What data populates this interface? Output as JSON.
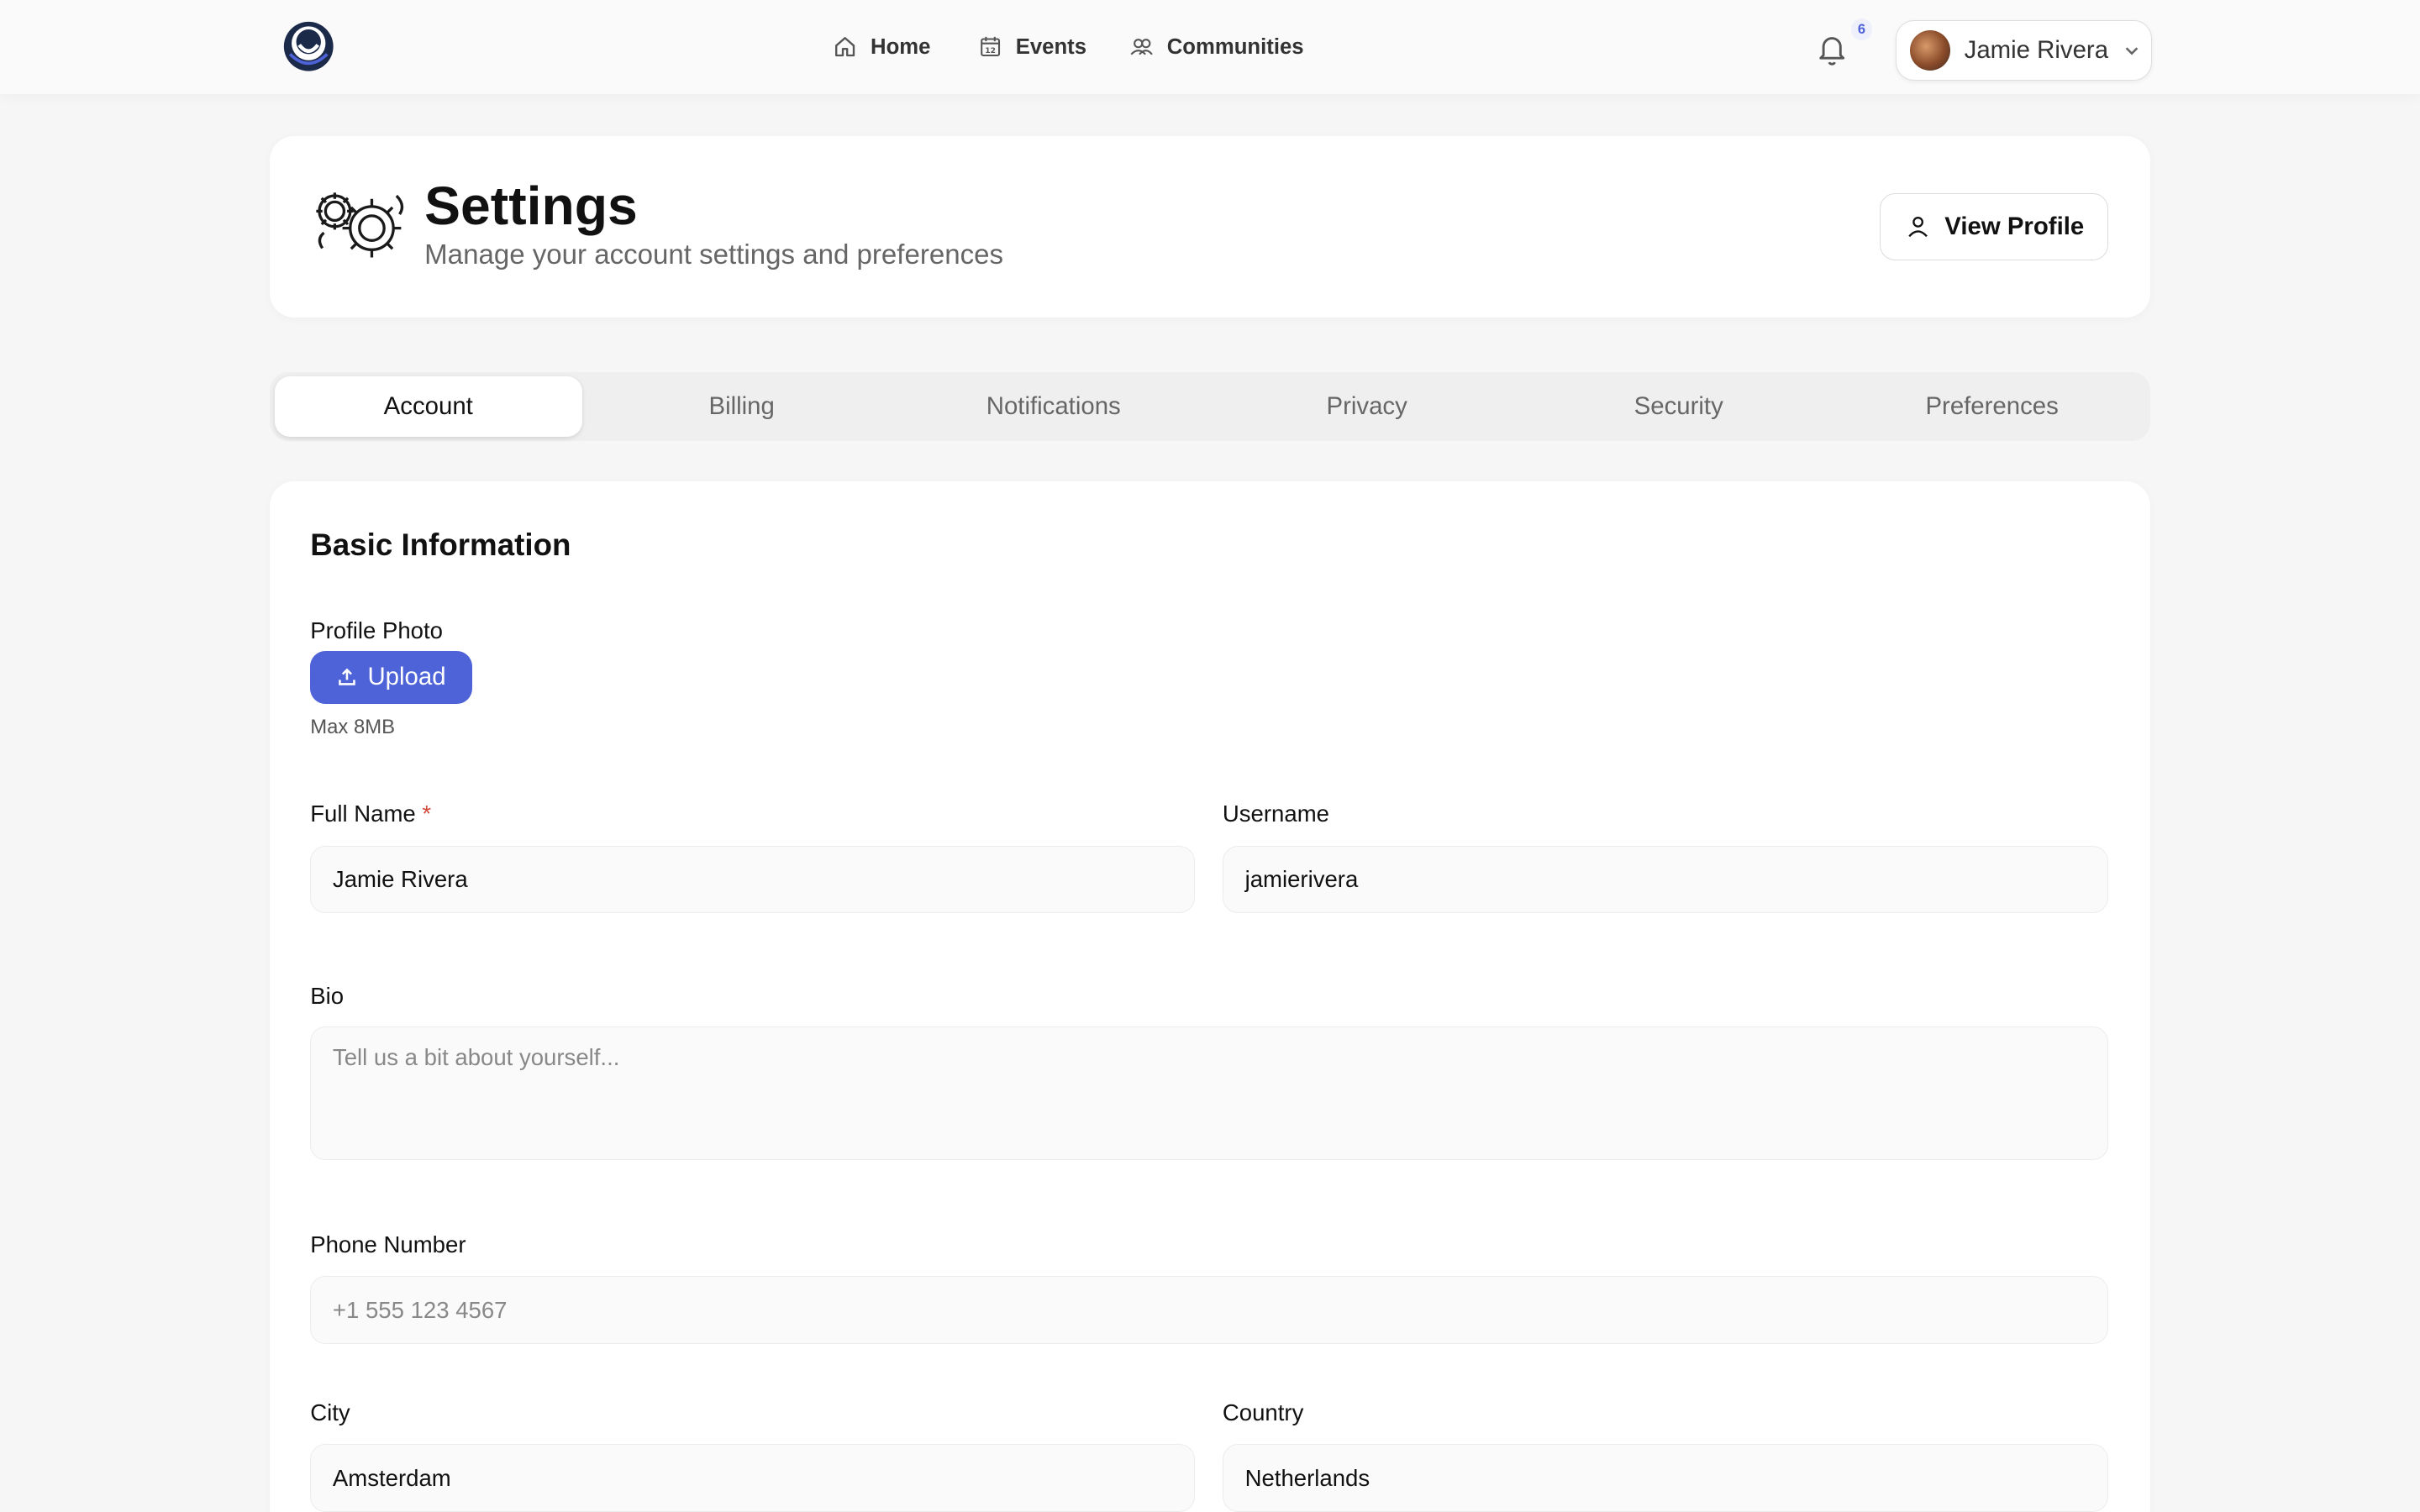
{
  "nav": {
    "home": "Home",
    "events": "Events",
    "communities": "Communities",
    "events_icon_num": "12",
    "notification_count": "6",
    "user_name": "Jamie Rivera"
  },
  "header": {
    "title": "Settings",
    "subtitle": "Manage your account settings and preferences",
    "view_profile": "View Profile"
  },
  "tabs": [
    "Account",
    "Billing",
    "Notifications",
    "Privacy",
    "Security",
    "Preferences"
  ],
  "active_tab": "Account",
  "form": {
    "section_title": "Basic Information",
    "profile_photo_label": "Profile Photo",
    "upload_label": "Upload",
    "upload_hint": "Max 8MB",
    "full_name_label": "Full Name",
    "required_marker": "*",
    "full_name_value": "Jamie Rivera",
    "username_label": "Username",
    "username_value": "jamierivera",
    "bio_label": "Bio",
    "bio_placeholder": "Tell us a bit about yourself...",
    "phone_label": "Phone Number",
    "phone_placeholder": "+1 555 123 4567",
    "city_label": "City",
    "city_value": "Amsterdam",
    "country_label": "Country",
    "country_value": "Netherlands"
  },
  "colors": {
    "accent": "#4f63d8",
    "required": "#d4473a",
    "background": "#f6f6f7"
  }
}
